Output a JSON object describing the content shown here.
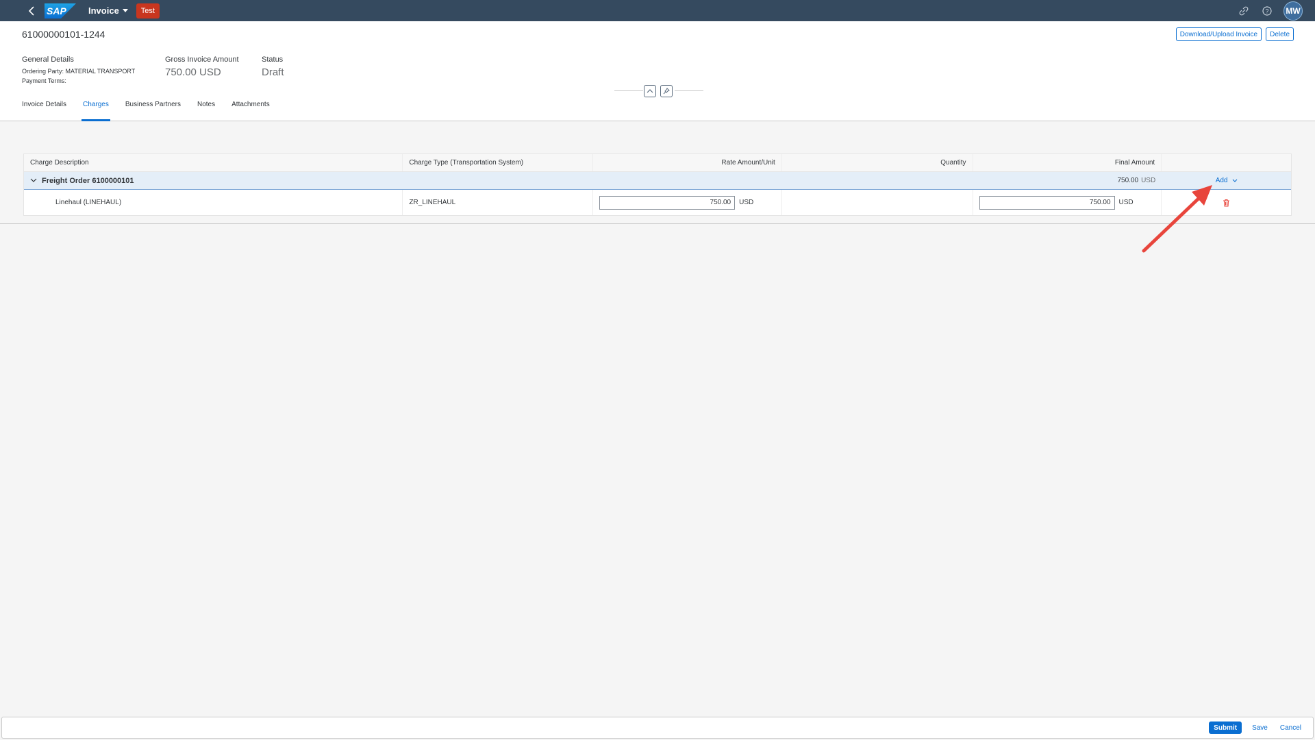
{
  "shell": {
    "logo": "SAP",
    "title": "Invoice",
    "environment_badge": "Test",
    "avatar_initials": "MW",
    "icons": [
      "back-icon",
      "link-icon",
      "help-icon"
    ]
  },
  "header": {
    "object_id": "61000000101-1244",
    "actions": {
      "download_upload": "Download/Upload Invoice",
      "delete": "Delete"
    },
    "general_details": {
      "label": "General Details",
      "ordering_party": "Ordering Party: MATERIAL TRANSPORT",
      "payment_terms": "Payment Terms:"
    },
    "gross_amount": {
      "label": "Gross Invoice Amount",
      "value": "750.00 USD"
    },
    "status": {
      "label": "Status",
      "value": "Draft"
    }
  },
  "tabs": [
    {
      "label": "Invoice Details",
      "active": false
    },
    {
      "label": "Charges",
      "active": true
    },
    {
      "label": "Business Partners",
      "active": false
    },
    {
      "label": "Notes",
      "active": false
    },
    {
      "label": "Attachments",
      "active": false
    }
  ],
  "charges": {
    "columns": [
      "Charge Description",
      "Charge Type (Transportation System)",
      "Rate Amount/Unit",
      "Quantity",
      "Final Amount",
      ""
    ],
    "group": {
      "title": "Freight Order 6100000101",
      "final_amount": "750.00",
      "final_currency": "USD",
      "add_label": "Add"
    },
    "items": [
      {
        "description": "Linehaul (LINEHAUL)",
        "charge_type": "ZR_LINEHAUL",
        "rate": "750.00",
        "rate_currency": "USD",
        "quantity": "",
        "final_amount": "750.00",
        "final_currency": "USD"
      }
    ]
  },
  "footer": {
    "submit": "Submit",
    "save": "Save",
    "cancel": "Cancel"
  },
  "colors": {
    "shell": "#354a5f",
    "accent": "#0a6ed1",
    "badge": "#c8361f",
    "annotation_arrow": "#e8453c"
  }
}
